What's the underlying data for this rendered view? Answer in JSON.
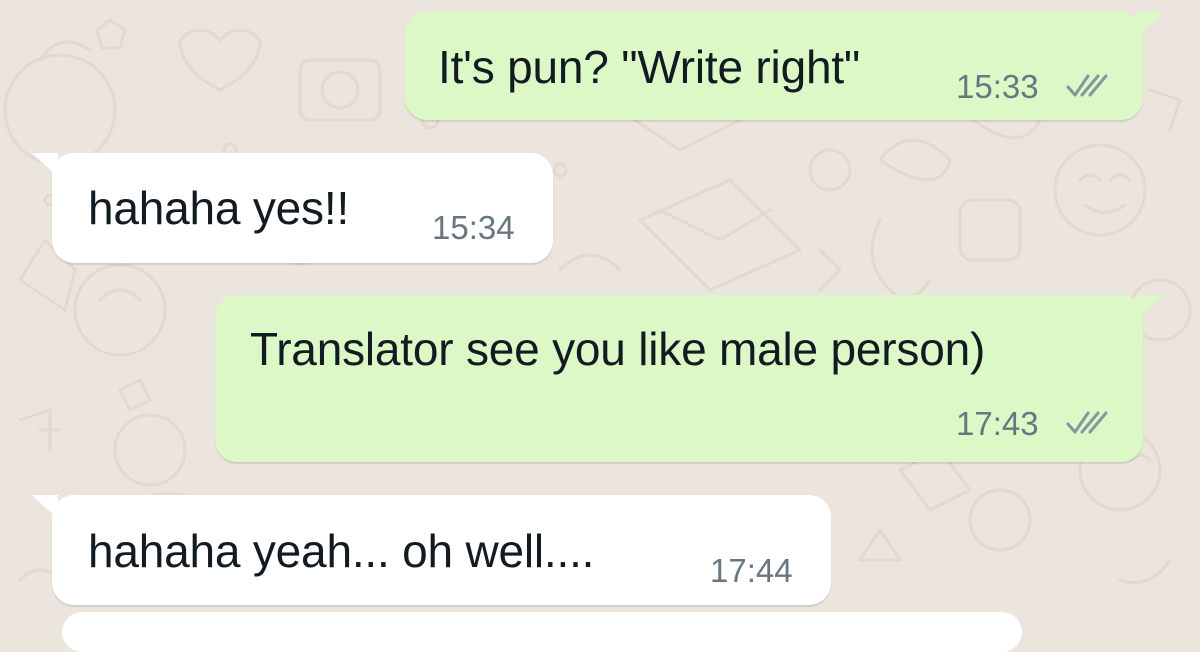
{
  "chat": {
    "background_color": "#ece5dd",
    "outgoing_bubble_color": "#dcf8c6",
    "incoming_bubble_color": "#ffffff",
    "tick_color": "#8696a0",
    "messages": [
      {
        "direction": "outgoing",
        "text": "It's pun? \"Write right\"",
        "time": "15:33",
        "status_icon": "double-check-icon"
      },
      {
        "direction": "incoming",
        "text": "hahaha yes!!",
        "time": "15:34"
      },
      {
        "direction": "outgoing",
        "text": "Translator see you like male person)",
        "time": "17:43",
        "status_icon": "double-check-icon"
      },
      {
        "direction": "incoming",
        "text": "hahaha yeah... oh well....",
        "time": "17:44"
      }
    ]
  }
}
